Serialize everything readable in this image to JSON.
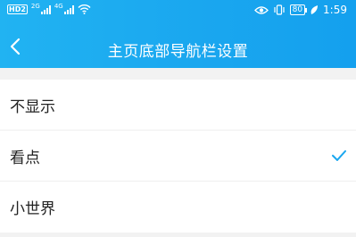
{
  "status_bar": {
    "hd_label": "HD",
    "hd_sim": "2",
    "net1": "2G",
    "net2": "4G",
    "battery": "80",
    "time": "1:59"
  },
  "header": {
    "title": "主页底部导航栏设置",
    "back_icon": "chevron-left-icon"
  },
  "options": [
    {
      "label": "不显示",
      "selected": false
    },
    {
      "label": "看点",
      "selected": true
    },
    {
      "label": "小世界",
      "selected": false
    }
  ],
  "colors": {
    "header_blue": "#1aa7ef",
    "check": "#1aa7ef",
    "page_bg": "#f2f2f2"
  }
}
